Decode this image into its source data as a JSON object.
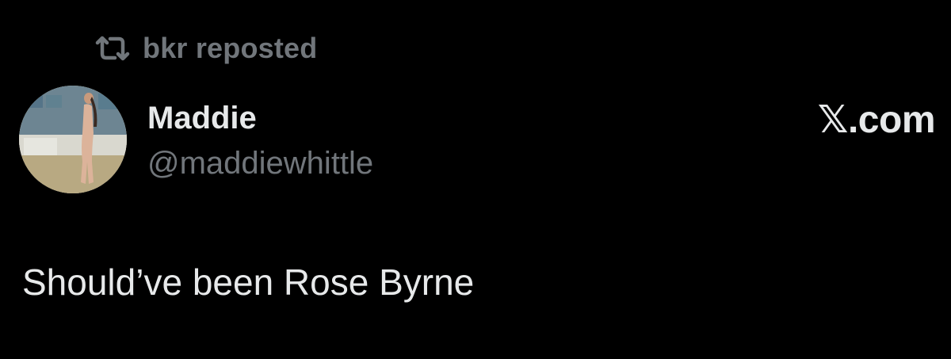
{
  "repost": {
    "icon": "repost-icon",
    "text": "bkr reposted"
  },
  "author": {
    "avatar": "avatar",
    "display_name": "Maddie",
    "handle": "@maddiewhittle"
  },
  "watermark": "𝕏.com",
  "tweet": {
    "text": "Should’ve been Rose Byrne"
  },
  "colors": {
    "background": "#000000",
    "primary_text": "#e7e9ea",
    "secondary_text": "#71767b"
  }
}
